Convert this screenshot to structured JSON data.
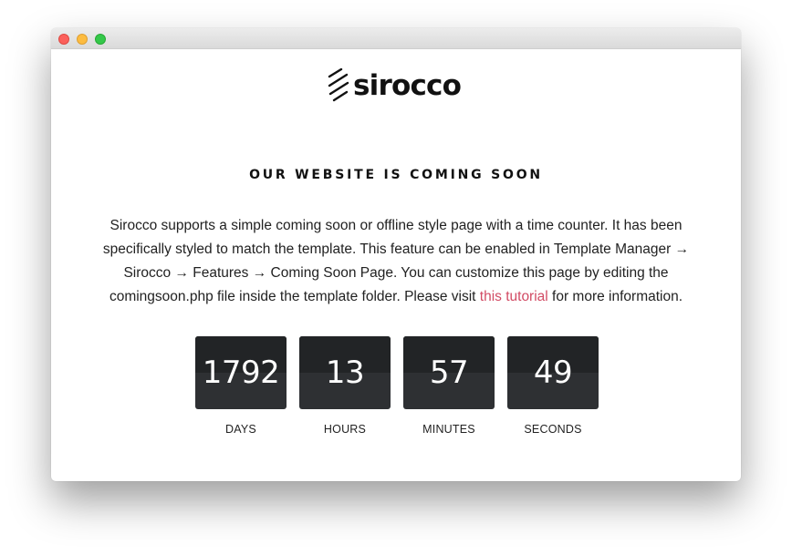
{
  "window": {
    "controls": [
      "close",
      "minimize",
      "maximize"
    ]
  },
  "logo": {
    "text": "sirocco",
    "icon": "diagonal-stripes-logo-icon"
  },
  "headline": "OUR WEBSITE IS COMING SOON",
  "description": {
    "text_before_link": "Sirocco supports a simple coming soon or offline style page with a time counter. It has been specifically styled to match the template. This feature can be enabled in Template Manager → Sirocco → Features → Coming Soon Page. You can customize this page by editing the comingsoon.php file inside the template folder. Please visit ",
    "link_text": "this tutorial",
    "text_after_link": " for more information."
  },
  "countdown": [
    {
      "value": "1792",
      "label": "DAYS"
    },
    {
      "value": "13",
      "label": "HOURS"
    },
    {
      "value": "57",
      "label": "MINUTES"
    },
    {
      "value": "49",
      "label": "SECONDS"
    }
  ],
  "colors": {
    "link": "#d24b64",
    "counter_top": "#222426",
    "counter_bottom": "#2e3033",
    "close": "#fc605b",
    "minimize": "#fdbc40",
    "maximize": "#34c84a"
  }
}
